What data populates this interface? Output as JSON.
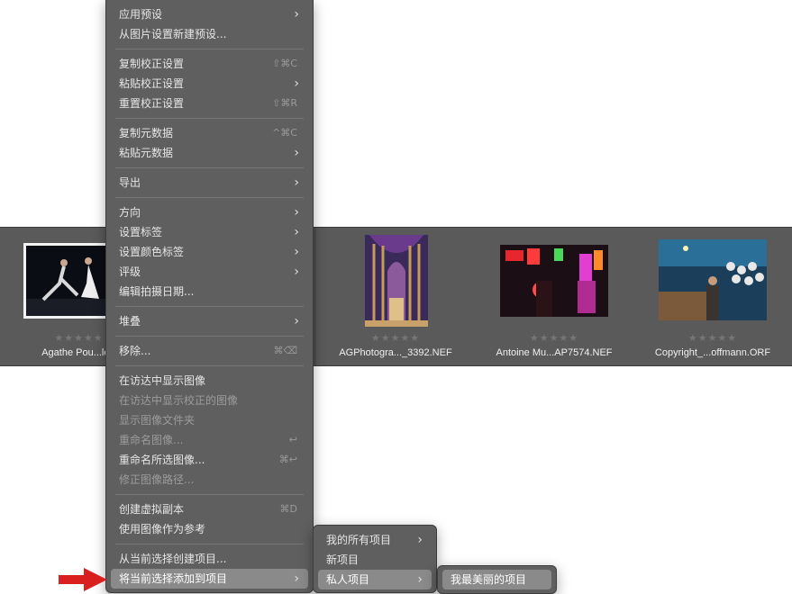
{
  "filmstrip": {
    "stars": "★★★★★",
    "items": [
      {
        "name": "Agathe Pou...leA"
      },
      {
        "name": "AGPhotogra..._3392.NEF"
      },
      {
        "name": "Antoine Mu...AP7574.NEF"
      },
      {
        "name": "Copyright_...offmann.ORF"
      }
    ]
  },
  "context_menu": {
    "items": {
      "apply_preset": "应用预设",
      "new_preset_from_image": "从图片设置新建预设...",
      "copy_adjustments": "复制校正设置",
      "copy_adjustments_sc": "⇧⌘C",
      "paste_adjustments": "粘贴校正设置",
      "reset_adjustments": "重置校正设置",
      "reset_adjustments_sc": "⇧⌘R",
      "copy_metadata": "复制元数据",
      "copy_metadata_sc": "^⌘C",
      "paste_metadata": "粘贴元数据",
      "export": "导出",
      "orientation": "方向",
      "set_label": "设置标签",
      "set_color_label": "设置颜色标签",
      "rating": "评级",
      "edit_capture_date": "编辑拍摄日期...",
      "stack": "堆叠",
      "remove": "移除...",
      "remove_sc": "⌘⌫",
      "show_in_finder": "在访达中显示图像",
      "show_adjusted_in_finder": "在访达中显示校正的图像",
      "show_image_folder": "显示图像文件夹",
      "rename_image": "重命名图像...",
      "rename_image_sc": "↩",
      "rename_selected": "重命名所选图像...",
      "rename_selected_sc": "⌘↩",
      "fix_image_path": "修正图像路径...",
      "create_virtual_copy": "创建虚拟副本",
      "create_virtual_copy_sc": "⌘D",
      "use_as_reference": "使用图像作为参考",
      "create_project_from_selection": "从当前选择创建项目...",
      "add_selection_to_project": "将当前选择添加到项目"
    }
  },
  "submenu": {
    "all_projects": "我的所有项目",
    "new_project": "新项目",
    "private_projects": "私人项目"
  },
  "submenu2": {
    "my_beautiful_project": "我最美丽的项目"
  },
  "colors": {
    "menu_bg": "#5f5f5f",
    "highlight": "#8a8a8a",
    "arrow_red": "#d9201e"
  }
}
